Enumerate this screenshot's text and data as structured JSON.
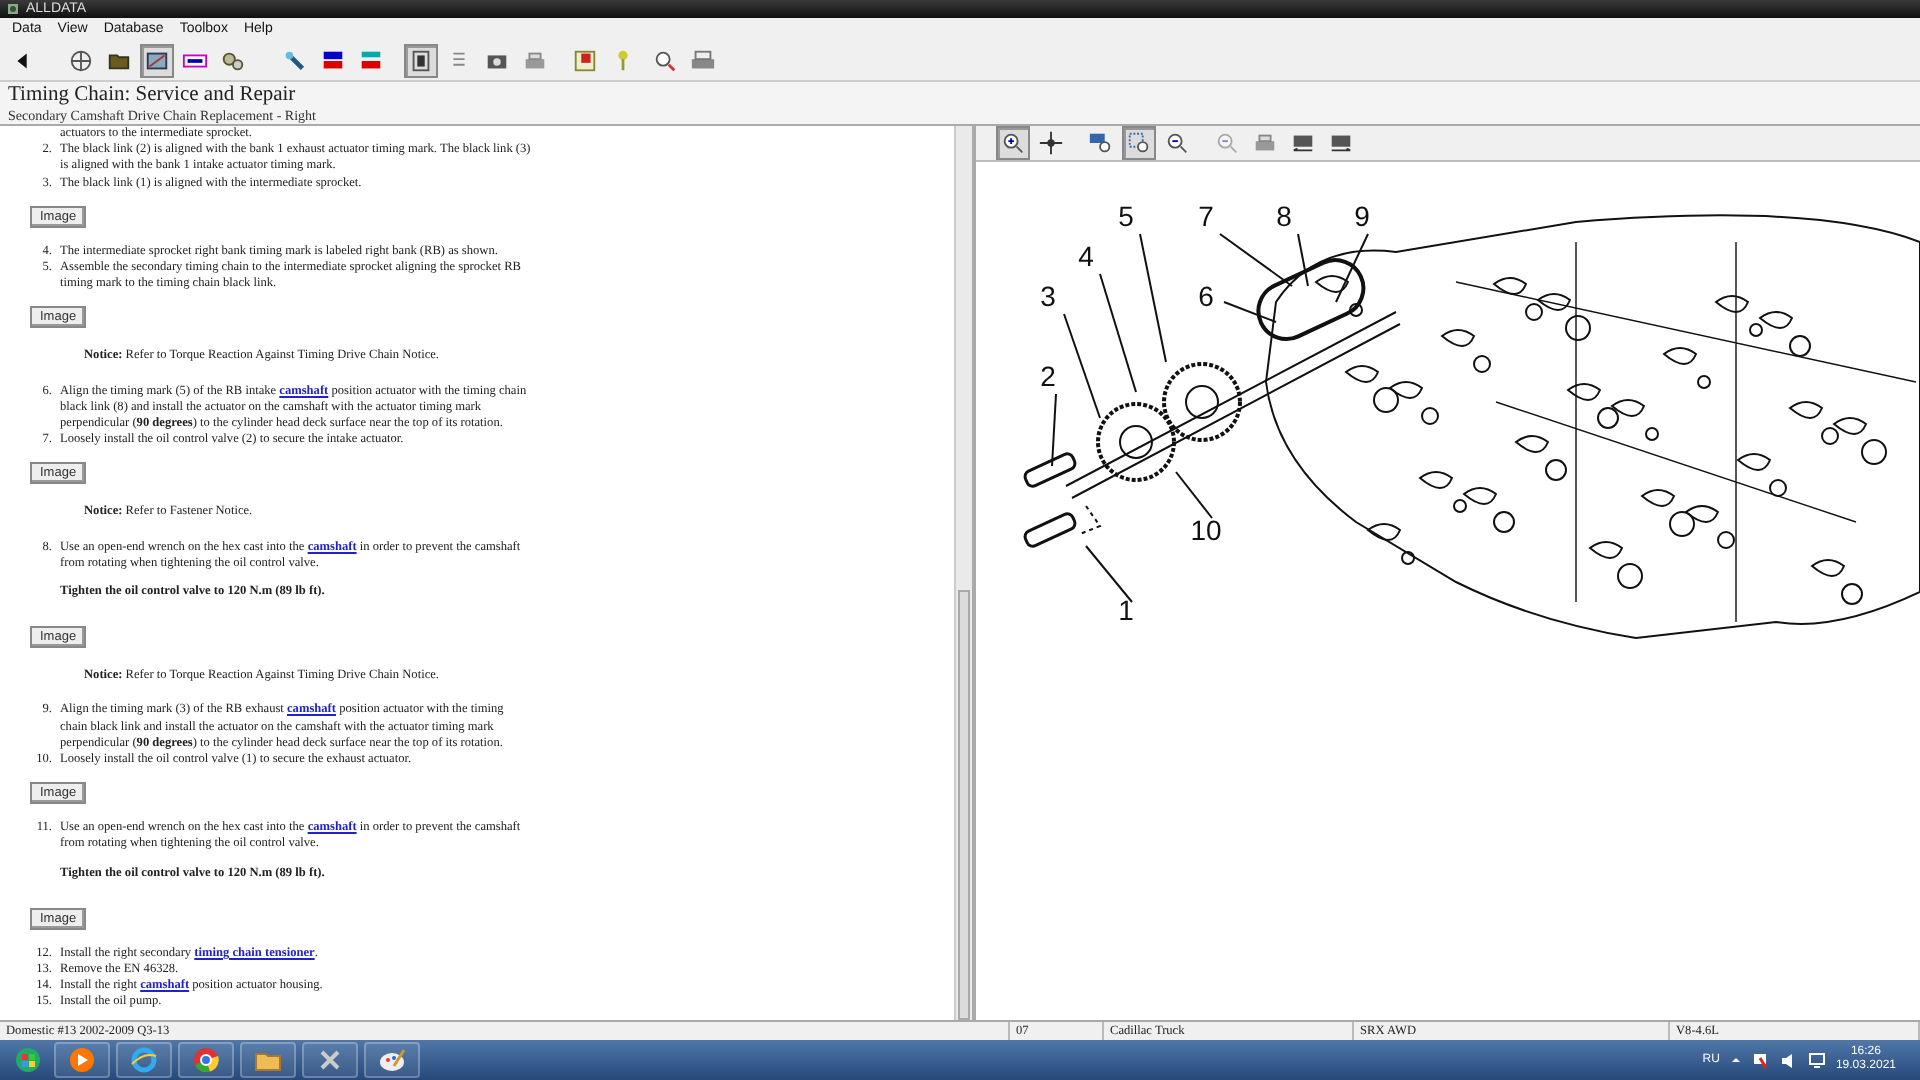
{
  "window": {
    "title": "ALLDATA"
  },
  "menu": [
    "Data",
    "View",
    "Database",
    "Toolbox",
    "Help"
  ],
  "toolbar": [
    {
      "pressed": false
    },
    {
      "pressed": false
    },
    {
      "pressed": false
    },
    {
      "pressed": true
    },
    {
      "pressed": false
    },
    {
      "pressed": false
    },
    {
      "pressed": false
    },
    {
      "pressed": false
    },
    {
      "pressed": false
    },
    {
      "pressed": true
    },
    {
      "pressed": false
    },
    {
      "pressed": false
    },
    {
      "pressed": false
    },
    {
      "pressed": false
    },
    {
      "pressed": false
    },
    {
      "pressed": false
    },
    {
      "pressed": false
    }
  ],
  "header": {
    "title": "Timing Chain:  Service and Repair",
    "subtitle": "Secondary Camshaft Drive Chain Replacement - Right"
  },
  "content": [
    {
      "kind": "continuation",
      "parts": [
        {
          "text": "actuators to the intermediate sprocket."
        }
      ]
    },
    {
      "kind": "step",
      "number": "2.",
      "parts": [
        {
          "text": "The black link (2) is aligned with the bank 1 exhaust actuator timing mark. The black link (3) is aligned with the bank 1 intake actuator timing mark."
        }
      ]
    },
    {
      "kind": "step",
      "number": "3.",
      "parts": [
        {
          "text": "The black link (1) is aligned with the intermediate sprocket."
        }
      ]
    },
    {
      "kind": "image_button",
      "label": "Image"
    },
    {
      "kind": "step",
      "number": "4.",
      "parts": [
        {
          "text": "The intermediate sprocket right bank timing mark is labeled right bank (RB) as shown."
        }
      ]
    },
    {
      "kind": "step",
      "number": "5.",
      "parts": [
        {
          "text": "Assemble the secondary timing chain to the intermediate sprocket aligning the sprocket RB timing mark to the timing chain black link."
        }
      ]
    },
    {
      "kind": "image_button",
      "label": "Image"
    },
    {
      "kind": "notice",
      "text": "**Notice:** Refer to Torque Reaction Against Timing Drive Chain Notice."
    },
    {
      "kind": "step",
      "number": "6.",
      "parts": [
        {
          "text": "Align the timing mark (5) of the RB intake "
        },
        {
          "link": "camshaft"
        },
        {
          "text": " position actuator with the timing chain black link (8) and install the actuator on the camshaft with the actuator timing mark perpendicular (**90 degrees**) to the cylinder head deck surface near the top of its rotation."
        }
      ]
    },
    {
      "kind": "step",
      "number": "7.",
      "parts": [
        {
          "text": "Loosely install the oil control valve (2) to secure the intake actuator."
        }
      ]
    },
    {
      "kind": "image_button",
      "label": "Image"
    },
    {
      "kind": "notice",
      "text": "**Notice:** Refer to Fastener Notice."
    },
    {
      "kind": "step",
      "number": "8.",
      "parts": [
        {
          "text": "Use an open-end wrench on the hex cast into the "
        },
        {
          "link": "camshaft"
        },
        {
          "text": " in order to prevent the camshaft from rotating when tightening the oil control valve."
        }
      ]
    },
    {
      "kind": "spec",
      "text": "Tighten the oil control valve to 120 N.m (89 lb ft)."
    },
    {
      "kind": "image_button",
      "label": "Image"
    },
    {
      "kind": "notice",
      "text": "**Notice:** Refer to Torque Reaction Against Timing Drive Chain Notice."
    },
    {
      "kind": "step",
      "number": "9.",
      "parts": [
        {
          "text": "Align the timing mark (3) of the RB exhaust "
        },
        {
          "link": "camshaft"
        },
        {
          "text": " position actuator with the timing chain black link and install the actuator on the camshaft with the actuator timing mark perpendicular (**90 degrees**) to the cylinder head deck surface near the top of its rotation."
        }
      ]
    },
    {
      "kind": "step",
      "number": "10.",
      "parts": [
        {
          "text": "Loosely install the oil control valve (1) to secure the exhaust actuator."
        }
      ]
    },
    {
      "kind": "image_button",
      "label": "Image"
    },
    {
      "kind": "step",
      "number": "11.",
      "parts": [
        {
          "text": "Use an open-end wrench on the hex cast into the "
        },
        {
          "link": "camshaft"
        },
        {
          "text": " in order to prevent the camshaft from rotating when tightening the oil control valve."
        }
      ]
    },
    {
      "kind": "spec",
      "text": "Tighten the oil control valve to 120 N.m (89 lb ft)."
    },
    {
      "kind": "image_button",
      "label": "Image"
    },
    {
      "kind": "step",
      "number": "12.",
      "parts": [
        {
          "text": "Install the right secondary "
        },
        {
          "link": "timing chain tensioner"
        },
        {
          "text": "."
        }
      ]
    },
    {
      "kind": "step",
      "number": "13.",
      "parts": [
        {
          "text": "Remove the EN 46328."
        }
      ]
    },
    {
      "kind": "step",
      "number": "14.",
      "parts": [
        {
          "text": "Install the right "
        },
        {
          "link": "camshaft"
        },
        {
          "text": " position actuator housing."
        }
      ]
    },
    {
      "kind": "step",
      "number": "15.",
      "parts": [
        {
          "text": "Install the oil pump."
        }
      ]
    }
  ],
  "image_toolbar": [
    {
      "pressed": true,
      "disabled": false
    },
    {
      "pressed": false,
      "disabled": false
    },
    {
      "pressed": false,
      "disabled": false
    },
    {
      "pressed": true,
      "disabled": false
    },
    {
      "pressed": false,
      "disabled": false
    },
    {
      "pressed": false,
      "disabled": true
    },
    {
      "pressed": false,
      "disabled": false
    },
    {
      "pressed": false,
      "disabled": false
    },
    {
      "pressed": false,
      "disabled": false
    }
  ],
  "diagram": {
    "callouts": [
      "5",
      "7",
      "8",
      "9",
      "4",
      "3",
      "6",
      "2",
      "10",
      "1"
    ]
  },
  "status_bar": [
    "Domestic #13 2002-2009 Q3-13",
    "07",
    "Cadillac Truck",
    "SRX AWD",
    "V8-4.6L"
  ],
  "taskbar": {
    "language": "RU",
    "time": "16:26",
    "date": "19.03.2021"
  }
}
